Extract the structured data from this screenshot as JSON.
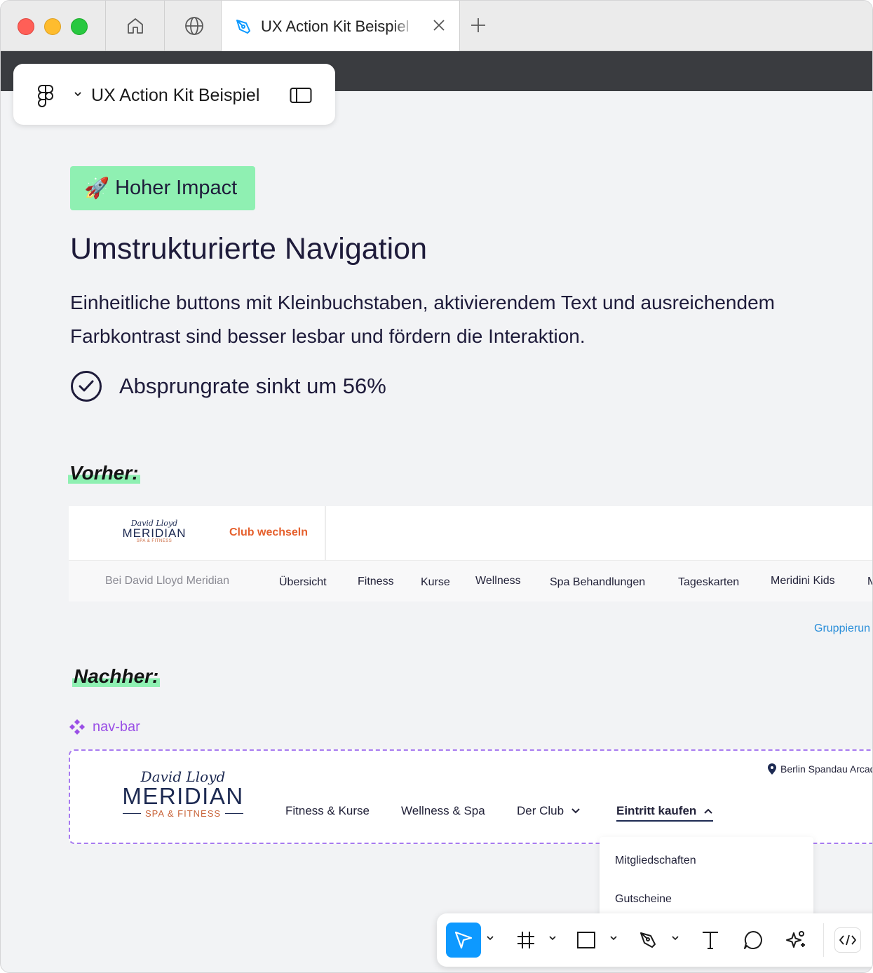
{
  "browser": {
    "tab_title": "UX Action Kit Beispiel"
  },
  "file": {
    "title": "UX Action Kit Beispiel"
  },
  "content": {
    "badge": {
      "emoji": "🚀",
      "label": "Hoher Impact",
      "color": "#8ff0b2"
    },
    "headline": "Umstrukturierte Navigation",
    "description": "Einheitliche buttons mit Kleinbuchstaben, aktivierendem Text und ausreichendem Farbkontrast sind besser lesbar und fördern die Interaktion.",
    "result": "Absprungrate sinkt um 56%",
    "before_label": "Vorher:",
    "after_label": "Nachher:"
  },
  "before_nav": {
    "logo_script": "David Lloyd",
    "logo_brand": "MERIDIAN",
    "logo_sub": "SPA & FITNESS",
    "club_switch": "Club wechseln",
    "club_switch_color": "#e5602d",
    "items": [
      "Bei David Lloyd Meridian",
      "Übersicht",
      "Fitness",
      "Kurse",
      "Wellness",
      "Spa Behandlungen",
      "Tageskarten",
      "Meridini Kids",
      "M"
    ]
  },
  "grouping_link": "Gruppierun",
  "component": {
    "name": "nav-bar",
    "color": "#9a4fe6"
  },
  "after_nav": {
    "logo_script": "David Lloyd",
    "logo_brand": "MERIDIAN",
    "logo_sub": "SPA & FITNESS",
    "location": "Berlin Spandau Arcad",
    "items": [
      "Fitness & Kurse",
      "Wellness & Spa",
      "Der Club",
      "Eintritt kaufen"
    ],
    "active_item": "Eintritt kaufen",
    "dropdown": [
      "Mitgliedschaften",
      "Gutscheine"
    ]
  },
  "toolbar": {
    "tools": [
      "move-tool",
      "frame-tool",
      "shape-tool",
      "pen-tool",
      "text-tool",
      "comment-tool",
      "actions-tool"
    ],
    "selected_tool": "move-tool",
    "accent": "#0d99ff"
  }
}
